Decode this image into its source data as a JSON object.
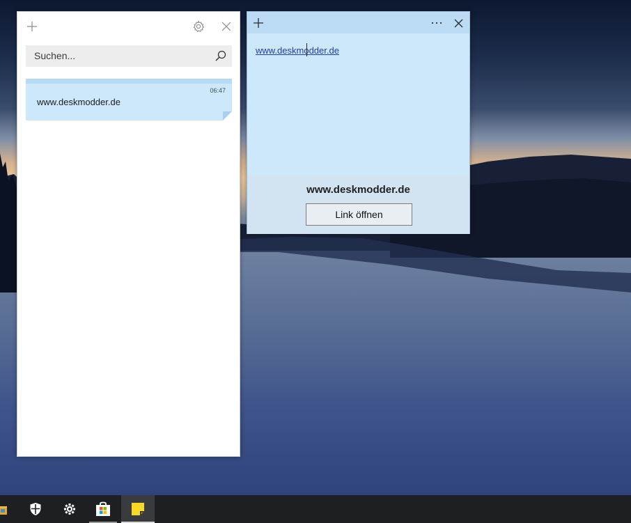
{
  "notes_list": {
    "search_placeholder": "Suchen...",
    "notes": [
      {
        "text": "www.deskmodder.de",
        "time": "06:47"
      }
    ]
  },
  "note_window": {
    "content_link": "www.deskmodder.de",
    "link_panel": {
      "title": "www.deskmodder.de",
      "open_button": "Link öffnen"
    }
  },
  "taskbar": {
    "items": [
      "file-explorer-icon",
      "windows-security-icon",
      "settings-icon",
      "microsoft-store-icon",
      "sticky-notes-icon"
    ]
  },
  "colors": {
    "note_blue": "#cde7fb",
    "note_titlebar": "#bcdcf6",
    "link": "#1f3ea8",
    "taskbar": "#1e1f22"
  }
}
